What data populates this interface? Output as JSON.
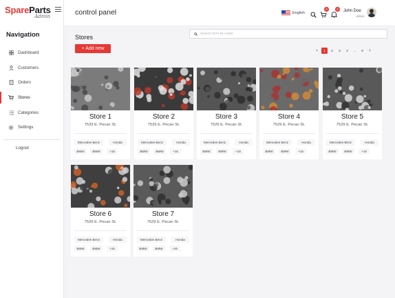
{
  "sidebar": {
    "logo_main_a": "Spare",
    "logo_main_b": "Parts",
    "logo_sub": "Admin",
    "nav_title": "Navigation",
    "items": [
      {
        "label": "Dashboard",
        "icon": "dashboard-icon"
      },
      {
        "label": "Customers",
        "icon": "user-icon"
      },
      {
        "label": "Orders",
        "icon": "orders-icon"
      },
      {
        "label": "Stores",
        "icon": "cart-icon",
        "active": true
      },
      {
        "label": "Categories",
        "icon": "list-icon"
      },
      {
        "label": "Settings",
        "icon": "gear-icon"
      }
    ],
    "logout": "Logout"
  },
  "header": {
    "title": "control panel",
    "language": "English",
    "cart_count": "0",
    "notification_count": "0",
    "user_name": "John Doe",
    "user_role": "Admin"
  },
  "main": {
    "section_title": "Stores",
    "add_button": "+  Add new",
    "search_placeholder": "Search here by name",
    "pagination": [
      "1",
      "2",
      "3",
      "4",
      "...",
      "9"
    ],
    "active_page": "1"
  },
  "stores": [
    {
      "name": "Store 1",
      "address": "7529 E. Pecan St.",
      "tags": [
        "Mercedes Benz",
        "Honda",
        "BMW",
        "BMW",
        "+16"
      ]
    },
    {
      "name": "Store 2",
      "address": "7529 E. Pecan St.",
      "tags": [
        "Mercedes Benz",
        "Honda",
        "BMW",
        "BMW",
        "+16"
      ]
    },
    {
      "name": "Store 3",
      "address": "7529 E. Pecan St.",
      "tags": [
        "Mercedes Benz",
        "Honda",
        "BMW",
        "BMW",
        "+16"
      ]
    },
    {
      "name": "Store 4",
      "address": "7529 E. Pecan St.",
      "tags": [
        "Mercedes Benz",
        "Honda",
        "BMW",
        "BMW",
        "+16"
      ]
    },
    {
      "name": "Store 5",
      "address": "7529 E. Pecan St.",
      "tags": [
        "Mercedes Benz",
        "Honda",
        "BMW",
        "BMW",
        "+16"
      ]
    },
    {
      "name": "Store 6",
      "address": "7529 E. Pecan St.",
      "tags": [
        "Mercedes Benz",
        "Honda",
        "BMW",
        "BMW",
        "+16"
      ]
    },
    {
      "name": "Store 7",
      "address": "7529 E. Pecan St.",
      "tags": [
        "Mercedes Benz",
        "Honda",
        "BMW",
        "BMW",
        "+16"
      ]
    }
  ],
  "colors": {
    "accent": "#e53935",
    "dark": "#1d1d24"
  }
}
